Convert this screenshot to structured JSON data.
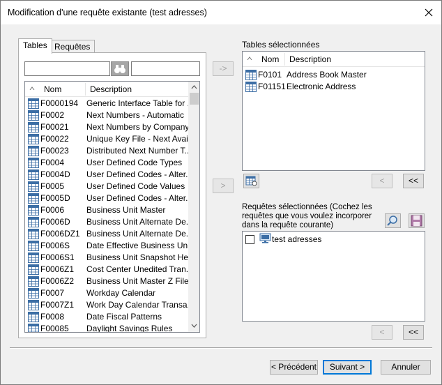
{
  "window": {
    "title": "Modification d'une requête existante (test adresses)"
  },
  "tabs": [
    {
      "label": "Tables",
      "active": true
    },
    {
      "label": "Requêtes",
      "active": false
    }
  ],
  "search": {
    "left_value": "",
    "right_value": ""
  },
  "tables_list": {
    "columns": [
      "Nom",
      "Description"
    ],
    "rows": [
      {
        "name": "F0000194",
        "desc": "Generic Interface Table for ..."
      },
      {
        "name": "F0002",
        "desc": "Next Numbers - Automatic"
      },
      {
        "name": "F00021",
        "desc": "Next Numbers by Company..."
      },
      {
        "name": "F00022",
        "desc": "Unique Key File - Next Avai..."
      },
      {
        "name": "F00023",
        "desc": "Distributed Next Number T..."
      },
      {
        "name": "F0004",
        "desc": "User Defined Code Types"
      },
      {
        "name": "F0004D",
        "desc": "User Defined Codes - Alter..."
      },
      {
        "name": "F0005",
        "desc": "User Defined Code Values"
      },
      {
        "name": "F0005D",
        "desc": "User Defined Codes - Alter..."
      },
      {
        "name": "F0006",
        "desc": "Business Unit Master"
      },
      {
        "name": "F0006D",
        "desc": "Business Unit Alternate De..."
      },
      {
        "name": "F0006DZ1",
        "desc": "Business Unit Alternate De..."
      },
      {
        "name": "F0006S",
        "desc": "Date Effective Business Un..."
      },
      {
        "name": "F0006S1",
        "desc": "Business Unit Snapshot He..."
      },
      {
        "name": "F0006Z1",
        "desc": "Cost Center Unedited Tran..."
      },
      {
        "name": "F0006Z2",
        "desc": "Business Unit Master Z  File"
      },
      {
        "name": "F0007",
        "desc": "Workday Calendar"
      },
      {
        "name": "F0007Z1",
        "desc": "Work Day Calendar Transa..."
      },
      {
        "name": "F0008",
        "desc": "Date Fiscal Patterns"
      },
      {
        "name": "F00085",
        "desc": "Daylight Savings Rules"
      }
    ]
  },
  "buttons": {
    "move_right_1": "->",
    "move_right_2": ">",
    "remove_1": "<",
    "remove_all_1": "<<",
    "remove_2": "<",
    "remove_all_2": "<<",
    "previous": "< Précédent",
    "next": "Suivant >",
    "cancel": "Annuler"
  },
  "selected_tables": {
    "label": "Tables sélectionnées",
    "columns": [
      "Nom",
      "Description"
    ],
    "rows": [
      {
        "name": "F0101",
        "desc": "Address Book Master"
      },
      {
        "name": "F01151",
        "desc": "Electronic Address"
      }
    ]
  },
  "selected_queries": {
    "label": "Requêtes sélectionnées (Cochez les requêtes que vous voulez incorporer dans la requête courante)",
    "items": [
      {
        "label": "test adresses",
        "checked": false
      }
    ]
  },
  "colors": {
    "accent": "#0078d7",
    "window_bg": "#f0f0f0",
    "table_icon": "#3c6ea5"
  }
}
